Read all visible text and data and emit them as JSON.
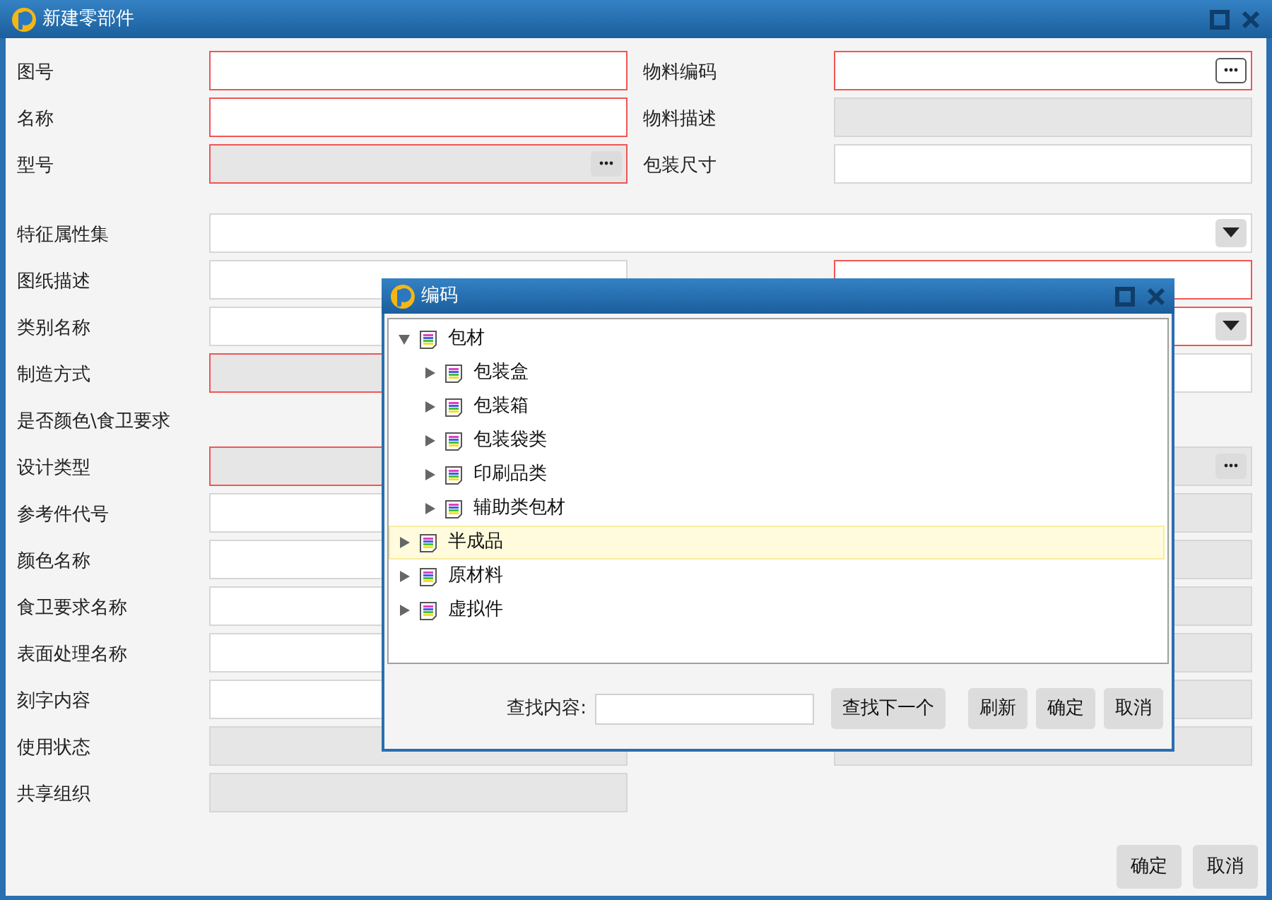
{
  "window": {
    "title": "新建零部件"
  },
  "rows": [
    {
      "kind": "pair",
      "left": {
        "label": "图号",
        "field": {
          "kind": "text",
          "required": true,
          "disabled": false
        }
      },
      "right": {
        "label": "物料编码",
        "field": {
          "kind": "lookup",
          "required": true,
          "disabled": false
        }
      }
    },
    {
      "kind": "pair",
      "left": {
        "label": "名称",
        "field": {
          "kind": "text",
          "required": true,
          "disabled": false
        }
      },
      "right": {
        "label": "物料描述",
        "field": {
          "kind": "text",
          "required": false,
          "disabled": true
        }
      }
    },
    {
      "kind": "pair",
      "left": {
        "label": "型号",
        "field": {
          "kind": "lookup",
          "required": true,
          "disabled": true
        }
      },
      "right": {
        "label": "包装尺寸",
        "field": {
          "kind": "text",
          "required": false,
          "disabled": false
        }
      }
    },
    {
      "kind": "wide",
      "left": {
        "label": "特征属性集",
        "field": {
          "kind": "dropdown",
          "required": false,
          "disabled": false
        }
      }
    },
    {
      "kind": "pair",
      "left": {
        "label": "图纸描述",
        "field": {
          "kind": "text",
          "required": false,
          "disabled": false
        }
      },
      "right": {
        "field": {
          "kind": "text",
          "required": true,
          "disabled": false
        }
      }
    },
    {
      "kind": "pair",
      "left": {
        "label": "类别名称",
        "field": {
          "kind": "text",
          "required": false,
          "disabled": false
        }
      },
      "right": {
        "field": {
          "kind": "dropdown",
          "required": true,
          "disabled": false
        }
      }
    },
    {
      "kind": "pair",
      "left": {
        "label": "制造方式",
        "field": {
          "kind": "text",
          "required": true,
          "disabled": true
        }
      },
      "right": {
        "field": {
          "kind": "text",
          "required": false,
          "disabled": false
        }
      }
    },
    {
      "kind": "pair",
      "left": {
        "label": "是否颜色\\食卫要求"
      }
    },
    {
      "kind": "pair",
      "left": {
        "label": "设计类型",
        "field": {
          "kind": "text",
          "required": true,
          "disabled": true
        }
      },
      "right": {
        "field": {
          "kind": "lookup",
          "required": false,
          "disabled": true
        }
      }
    },
    {
      "kind": "pair",
      "left": {
        "label": "参考件代号",
        "field": {
          "kind": "text",
          "required": false,
          "disabled": false
        }
      },
      "right": {
        "field": {
          "kind": "text",
          "required": false,
          "disabled": true
        }
      }
    },
    {
      "kind": "pair",
      "left": {
        "label": "颜色名称",
        "field": {
          "kind": "text",
          "required": false,
          "disabled": false
        }
      },
      "right": {
        "field": {
          "kind": "text",
          "required": false,
          "disabled": true
        }
      }
    },
    {
      "kind": "pair",
      "left": {
        "label": "食卫要求名称",
        "field": {
          "kind": "text",
          "required": false,
          "disabled": false
        }
      },
      "right": {
        "field": {
          "kind": "text",
          "required": false,
          "disabled": true
        }
      }
    },
    {
      "kind": "pair",
      "left": {
        "label": "表面处理名称",
        "field": {
          "kind": "text",
          "required": false,
          "disabled": false
        }
      },
      "right": {
        "field": {
          "kind": "text",
          "required": false,
          "disabled": true
        }
      }
    },
    {
      "kind": "pair",
      "left": {
        "label": "刻字内容",
        "field": {
          "kind": "text",
          "required": false,
          "disabled": false
        }
      },
      "right": {
        "field": {
          "kind": "text",
          "required": false,
          "disabled": true
        }
      }
    },
    {
      "kind": "pair",
      "left": {
        "label": "使用状态",
        "field": {
          "kind": "text",
          "required": false,
          "disabled": true
        }
      },
      "right": {
        "field": {
          "kind": "text",
          "required": false,
          "disabled": true
        }
      }
    },
    {
      "kind": "pair",
      "left": {
        "label": "共享组织",
        "field": {
          "kind": "text",
          "required": false,
          "disabled": true
        }
      }
    }
  ],
  "buttons": [
    "确定",
    "取消"
  ],
  "dialog": {
    "title": "编码",
    "tree": [
      {
        "label": "包材",
        "expanded": true,
        "selected": false,
        "children": [
          {
            "label": "包装盒",
            "expanded": false,
            "selected": false
          },
          {
            "label": "包装箱",
            "expanded": false,
            "selected": false
          },
          {
            "label": "包装袋类",
            "expanded": false,
            "selected": false
          },
          {
            "label": "印刷品类",
            "expanded": false,
            "selected": false
          },
          {
            "label": "辅助类包材",
            "expanded": false,
            "selected": false
          }
        ]
      },
      {
        "label": "半成品",
        "expanded": false,
        "selected": true
      },
      {
        "label": "原材料",
        "expanded": false,
        "selected": false
      },
      {
        "label": "虚拟件",
        "expanded": false,
        "selected": false
      }
    ],
    "search_label": "查找内容:",
    "buttons": [
      "查找下一个",
      "刷新",
      "确定",
      "取消"
    ]
  }
}
